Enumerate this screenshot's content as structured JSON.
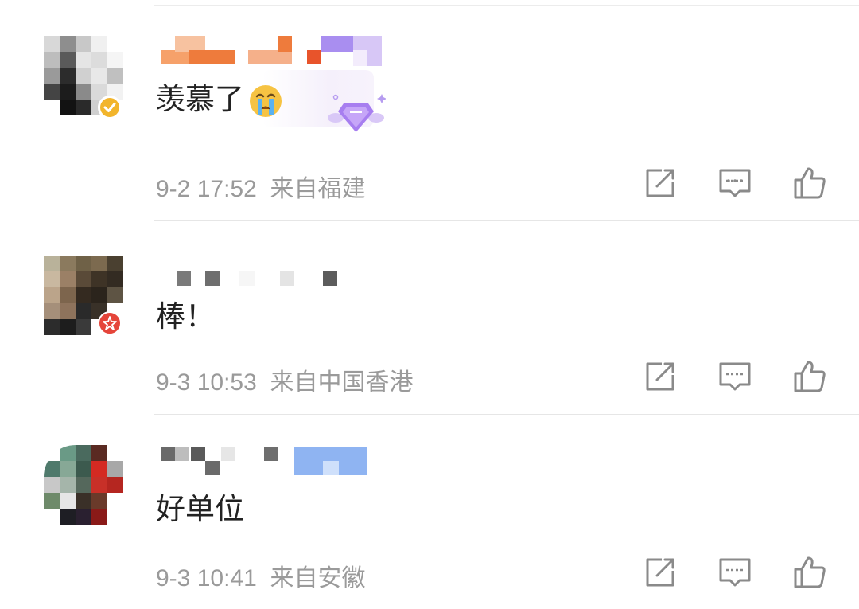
{
  "comments": [
    {
      "content": "羡慕了",
      "emoji": "crying-emoji",
      "time": "9-2 17:52",
      "location": "来自福建",
      "badge": "verified-badge-icon"
    },
    {
      "content": "棒！",
      "time": "9-3 10:53",
      "location": "来自中国香港",
      "badge": "star-badge-icon"
    },
    {
      "content": "好单位",
      "time": "9-3 10:41",
      "location": "来自安徽"
    }
  ],
  "icons": {
    "share": "share-icon",
    "comment": "comment-icon",
    "like": "like-icon"
  },
  "colors": {
    "meta_text": "#9a9a9a",
    "content_text": "#222222",
    "icon_stroke": "#8a8a8a",
    "verified_badge": "#f2b52c",
    "star_badge": "#e5453a"
  }
}
